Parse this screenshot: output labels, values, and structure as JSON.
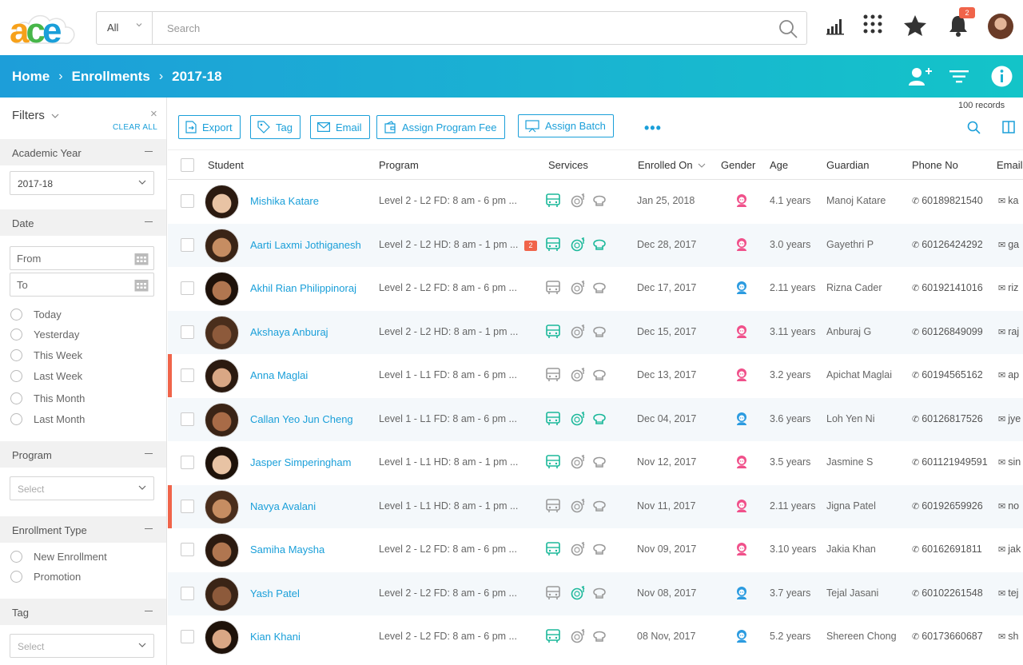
{
  "logo": {
    "text": "ace"
  },
  "search": {
    "scope": "All",
    "placeholder": "Search"
  },
  "top": {
    "notification_count": "2"
  },
  "breadcrumb": {
    "home": "Home",
    "enrollments": "Enrollments",
    "year": "2017-18"
  },
  "filters": {
    "title": "Filters",
    "clear_all": "CLEAR ALL",
    "academic_year": {
      "label": "Academic Year",
      "value": "2017-18"
    },
    "date": {
      "label": "Date",
      "from_placeholder": "From",
      "to_placeholder": "To",
      "options": [
        "Today",
        "Yesterday",
        "This Week",
        "Last Week",
        "This Month",
        "Last Month"
      ]
    },
    "program": {
      "label": "Program",
      "placeholder": "Select"
    },
    "enrollment_type": {
      "label": "Enrollment Type",
      "options": [
        "New Enrollment",
        "Promotion"
      ]
    },
    "tag": {
      "label": "Tag",
      "placeholder": "Select"
    }
  },
  "toolbar": {
    "export": "Export",
    "tag": "Tag",
    "email": "Email",
    "assign_fee": "Assign Program Fee",
    "assign_batch": "Assign Batch",
    "more": "•••",
    "records": "100 records"
  },
  "columns": {
    "student": "Student",
    "program": "Program",
    "services": "Services",
    "enrolled_on": "Enrolled On",
    "gender": "Gender",
    "age": "Age",
    "guardian": "Guardian",
    "phone": "Phone No",
    "email": "Email"
  },
  "colors": {
    "accent": "#1a9fd9",
    "active_service": "#1bb89a",
    "inactive_service": "#9a9a9a",
    "female": "#f0508a",
    "male": "#2b9be0",
    "flag": "#f0644a"
  },
  "rows": [
    {
      "name": "Mishika Katare",
      "program": "Level 2 - L2 FD:  8 am - 6 pm ...",
      "badge": "",
      "services": [
        1,
        0,
        0
      ],
      "enrolled": "Jan 25, 2018",
      "gender": "female",
      "age": "4.1 years",
      "guardian": "Manoj Katare",
      "phone": "60189821540",
      "email": "ka",
      "flag": false
    },
    {
      "name": "Aarti Laxmi Jothiganesh",
      "program": "Level 2 - L2 HD: 8 am - 1 pm ...",
      "badge": "2",
      "services": [
        1,
        1,
        1
      ],
      "enrolled": "Dec 28, 2017",
      "gender": "female",
      "age": "3.0 years",
      "guardian": "Gayethri P",
      "phone": "60126424292",
      "email": "ga",
      "flag": false
    },
    {
      "name": "Akhil Rian Philippinoraj",
      "program": "Level 2 - L2 FD: 8 am - 6 pm ...",
      "badge": "",
      "services": [
        0,
        0,
        0
      ],
      "enrolled": "Dec 17, 2017",
      "gender": "male",
      "age": "2.11 years",
      "guardian": "Rizna  Cader",
      "phone": "60192141016",
      "email": "riz",
      "flag": false
    },
    {
      "name": "Akshaya Anburaj",
      "program": "Level 2 - L2 HD: 8 am - 1 pm ...",
      "badge": "",
      "services": [
        1,
        0,
        0
      ],
      "enrolled": "Dec 15, 2017",
      "gender": "female",
      "age": "3.11 years",
      "guardian": "Anburaj G",
      "phone": "60126849099",
      "email": "raj",
      "flag": false
    },
    {
      "name": "Anna Maglai",
      "program": "Level 1 - L1 FD: 8 am - 6 pm ...",
      "badge": "",
      "services": [
        0,
        0,
        0
      ],
      "enrolled": "Dec 13, 2017",
      "gender": "female",
      "age": "3.2 years",
      "guardian": "Apichat Maglai",
      "phone": "60194565162",
      "email": "ap",
      "flag": true
    },
    {
      "name": "Callan Yeo Jun Cheng",
      "program": "Level 1 - L1 FD: 8 am - 6 pm ...",
      "badge": "",
      "services": [
        1,
        1,
        1
      ],
      "enrolled": "Dec 04, 2017",
      "gender": "male",
      "age": "3.6 years",
      "guardian": "Loh Yen Ni",
      "phone": "60126817526",
      "email": "jye",
      "flag": false
    },
    {
      "name": "Jasper Simperingham",
      "program": "Level 1 - L1 HD: 8 am - 1 pm ...",
      "badge": "",
      "services": [
        1,
        0,
        0
      ],
      "enrolled": "Nov 12, 2017",
      "gender": "female",
      "age": "3.5 years",
      "guardian": "Jasmine S",
      "phone": "601121949591",
      "email": "sin",
      "flag": false
    },
    {
      "name": "Navya Avalani",
      "program": "Level 1 - L1 HD: 8 am - 1 pm ...",
      "badge": "",
      "services": [
        0,
        0,
        0
      ],
      "enrolled": "Nov 11, 2017",
      "gender": "female",
      "age": "2.11 years",
      "guardian": "Jigna  Patel",
      "phone": "60192659926",
      "email": "no",
      "flag": true
    },
    {
      "name": "Samiha Maysha",
      "program": "Level 2 - L2 FD:  8 am - 6 pm ...",
      "badge": "",
      "services": [
        1,
        0,
        0
      ],
      "enrolled": "Nov 09, 2017",
      "gender": "female",
      "age": "3.10 years",
      "guardian": "Jakia Khan",
      "phone": "60162691811",
      "email": "jak",
      "flag": false
    },
    {
      "name": "Yash Patel",
      "program": "Level 2 - L2 FD: 8 am - 6 pm ...",
      "badge": "",
      "services": [
        0,
        1,
        0
      ],
      "enrolled": "Nov 08, 2017",
      "gender": "male",
      "age": "3.7 years",
      "guardian": "Tejal  Jasani",
      "phone": "60102261548",
      "email": "tej",
      "flag": false
    },
    {
      "name": "Kian Khani",
      "program": "Level 2 - L2 FD:  8 am - 6 pm ...",
      "badge": "",
      "services": [
        1,
        0,
        0
      ],
      "enrolled": "08 Nov, 2017",
      "gender": "male",
      "age": "5.2 years",
      "guardian": "Shereen  Chong",
      "phone": "60173660687",
      "email": "sh",
      "flag": false
    }
  ]
}
